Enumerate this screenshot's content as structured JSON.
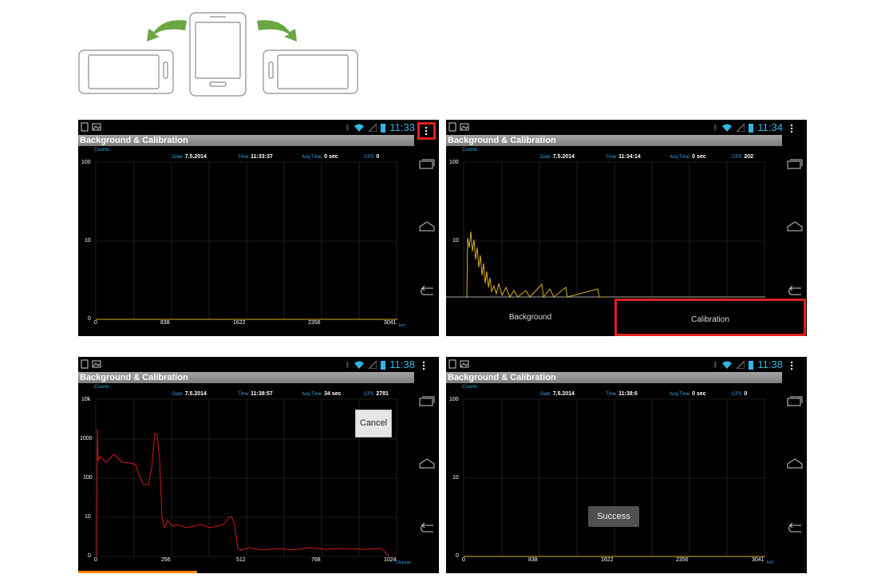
{
  "app_title": "Background & Calibration",
  "colors": {
    "accent": "#33b5e5",
    "highlight": "#e0211d",
    "spectrum_yellow": "#d8b020",
    "spectrum_red": "#d31818",
    "progress": "#ff8800"
  },
  "screens": [
    {
      "time": "11:33",
      "info": {
        "counts_label": "Counts",
        "date_label": "Date",
        "date": "7.5.2014",
        "time_label": "Time",
        "time": "11:33:37",
        "acq_label": "Acq.Time",
        "acq": "0 sec",
        "cps_label": "CPS",
        "cps": "0"
      },
      "y_ticks": [
        "100",
        "10",
        "0"
      ],
      "x_ticks": [
        "0",
        "838",
        "1622",
        "2356",
        "3041"
      ],
      "x_unit": "keV"
    },
    {
      "time": "11:34",
      "info": {
        "counts_label": "Counts",
        "date_label": "Date",
        "date": "7.5.2014",
        "time_label": "Time",
        "time": "11:34:14",
        "acq_label": "Acq.Time",
        "acq": "0 sec",
        "cps_label": "CPS",
        "cps": "202"
      },
      "y_ticks": [
        "100",
        "10"
      ],
      "menu": {
        "background": "Background",
        "calibration": "Calibration"
      }
    },
    {
      "time": "11:38",
      "info": {
        "counts_label": "Counts",
        "date_label": "Date",
        "date": "7.5.2014",
        "time_label": "Time",
        "time": "11:38:57",
        "acq_label": "Acq.Time",
        "acq": "34 sec",
        "cps_label": "CPS",
        "cps": "2781"
      },
      "y_ticks": [
        "10k",
        "1000",
        "100",
        "10",
        "0"
      ],
      "x_ticks": [
        "0",
        "256",
        "512",
        "768",
        "1024"
      ],
      "x_unit": "Channel",
      "cancel_label": "Cancel",
      "progress": 0.33
    },
    {
      "time": "11:38",
      "info": {
        "counts_label": "Counts",
        "date_label": "Date",
        "date": "7.5.2014",
        "time_label": "Time",
        "time": "11:38:6",
        "acq_label": "Acq.Time",
        "acq": "0 sec",
        "cps_label": "CPS",
        "cps": "0"
      },
      "y_ticks": [
        "100",
        "10",
        "0"
      ],
      "x_ticks": [
        "0",
        "838",
        "1622",
        "2356",
        "3041"
      ],
      "x_unit": "keV",
      "toast": "Success"
    }
  ]
}
